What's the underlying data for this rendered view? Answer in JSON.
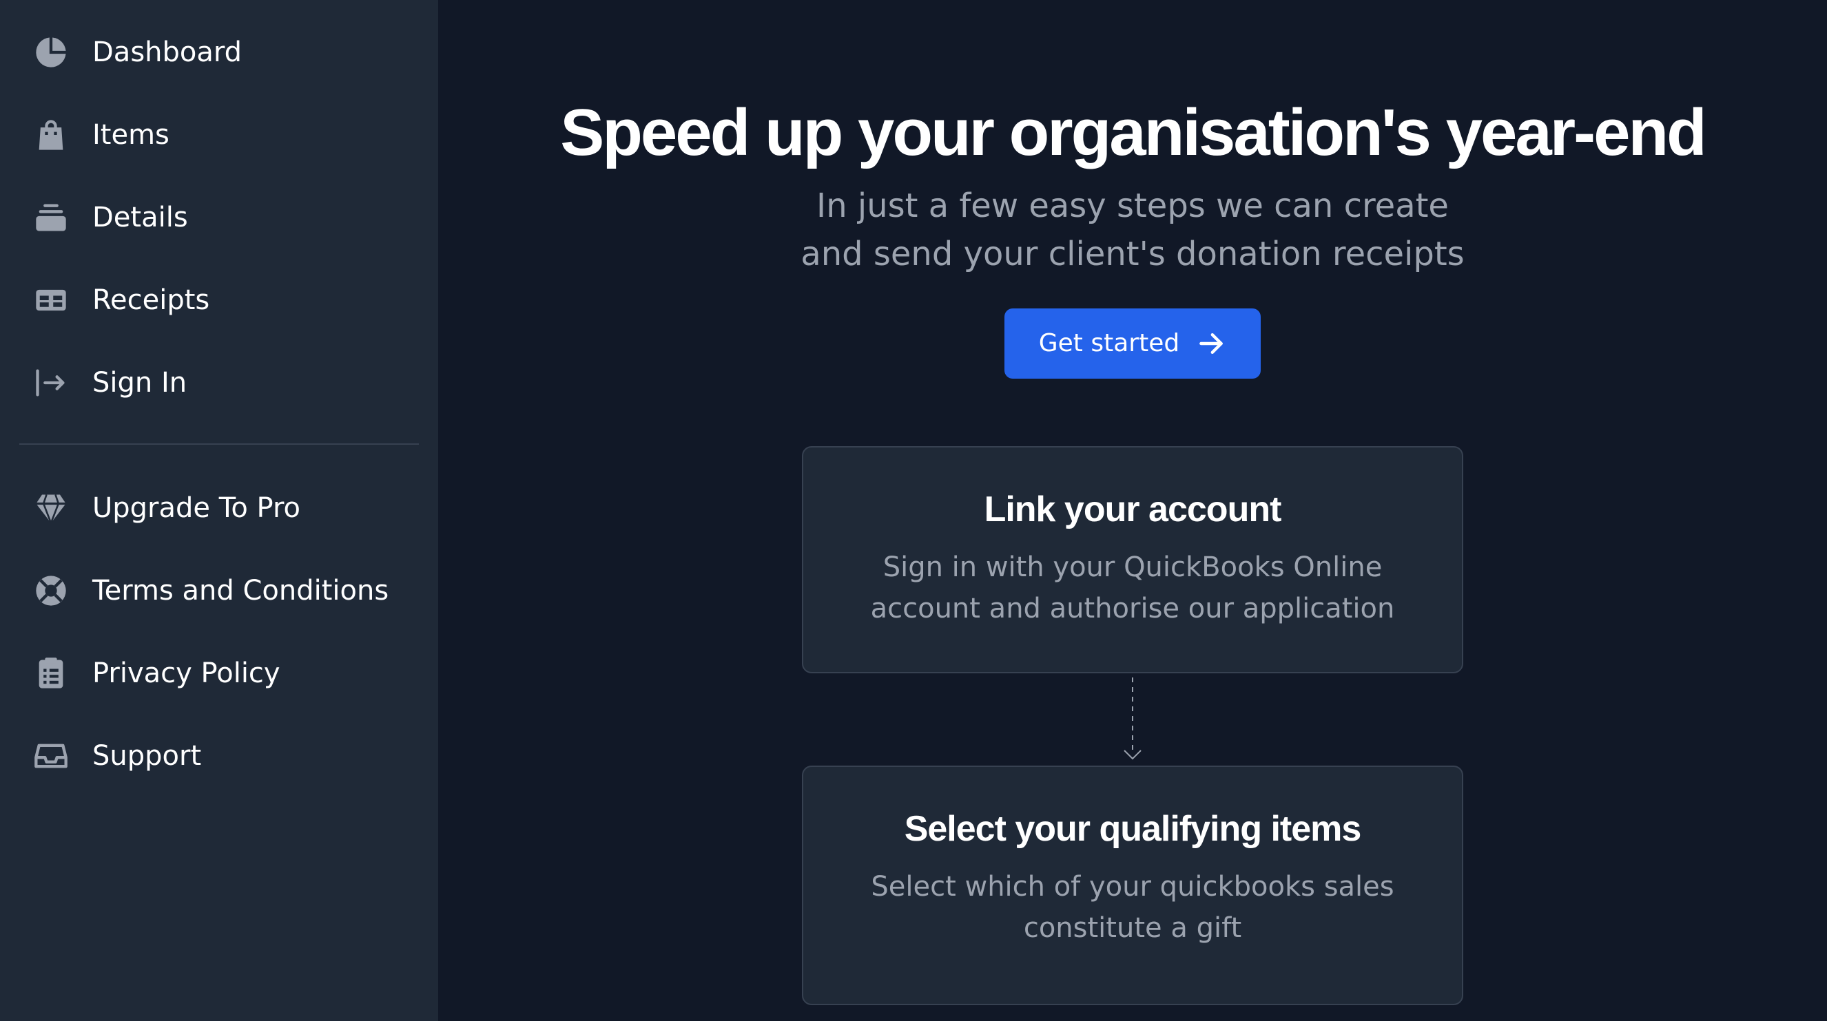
{
  "sidebar": {
    "primary_items": [
      {
        "label": "Dashboard",
        "icon": "pie-chart-icon"
      },
      {
        "label": "Items",
        "icon": "shopping-bag-icon"
      },
      {
        "label": "Details",
        "icon": "stack-icon"
      },
      {
        "label": "Receipts",
        "icon": "table-icon"
      },
      {
        "label": "Sign In",
        "icon": "sign-in-arrow-icon"
      }
    ],
    "secondary_items": [
      {
        "label": "Upgrade To Pro",
        "icon": "gem-icon"
      },
      {
        "label": "Terms and Conditions",
        "icon": "life-buoy-icon"
      },
      {
        "label": "Privacy Policy",
        "icon": "clipboard-list-icon"
      },
      {
        "label": "Support",
        "icon": "inbox-icon"
      }
    ]
  },
  "hero": {
    "title": "Speed up your organisation's year-end",
    "subtitle": "In just a few easy steps we can create and send your client's donation receipts",
    "cta_label": "Get started"
  },
  "steps": [
    {
      "title": "Link your account",
      "text": "Sign in with your QuickBooks Online account and authorise our application"
    },
    {
      "title": "Select your qualifying items",
      "text": "Select which of your quickbooks sales constitute a gift"
    }
  ],
  "colors": {
    "sidebar_bg": "#1f2937",
    "main_bg": "#111827",
    "accent": "#2563eb",
    "muted_text": "#9ca3af"
  }
}
